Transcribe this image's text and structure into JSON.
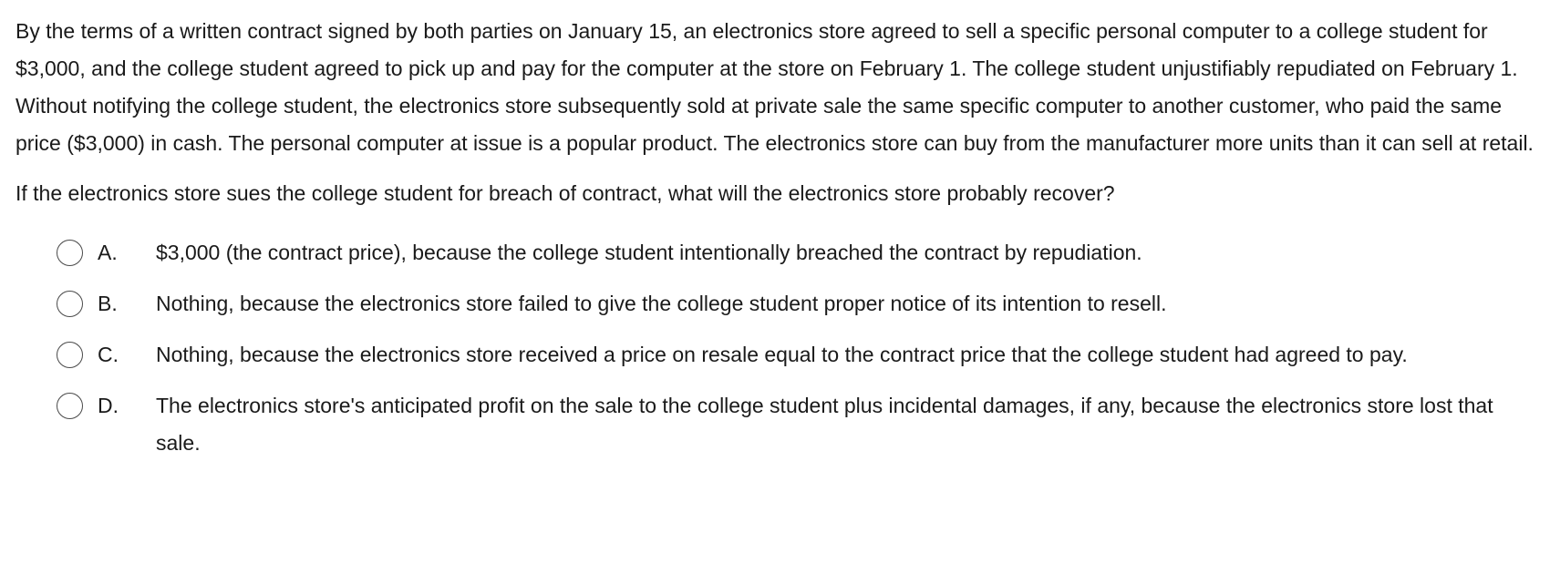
{
  "question": {
    "stem": "By the terms of a written contract signed by both parties on January 15, an electronics store agreed to sell a specific personal computer to a college student for $3,000, and the college student agreed to pick up and pay for the computer at the store on February 1.  The college student unjustifiably repudiated on February 1.  Without notifying the college student, the electronics store subsequently sold at private sale the same specific computer to another customer, who paid the same price ($3,000) in cash.  The personal computer at issue is a popular product.  The electronics store can buy from the manufacturer more units than it can sell at retail.",
    "prompt": "If the electronics store sues the college student for breach of contract, what will the electronics store probably recover?"
  },
  "options": [
    {
      "letter": "A.",
      "text": "$3,000 (the contract price), because the college student intentionally breached the contract by repudiation."
    },
    {
      "letter": "B.",
      "text": "Nothing, because the electronics store failed to give the college student proper notice of its intention to resell."
    },
    {
      "letter": "C.",
      "text": "Nothing, because the electronics store received a price on resale equal to the contract price that the college student had agreed to pay."
    },
    {
      "letter": "D.",
      "text": "The electronics store's anticipated profit on the sale to the college student plus incidental damages, if any, because the electronics store lost that sale."
    }
  ]
}
